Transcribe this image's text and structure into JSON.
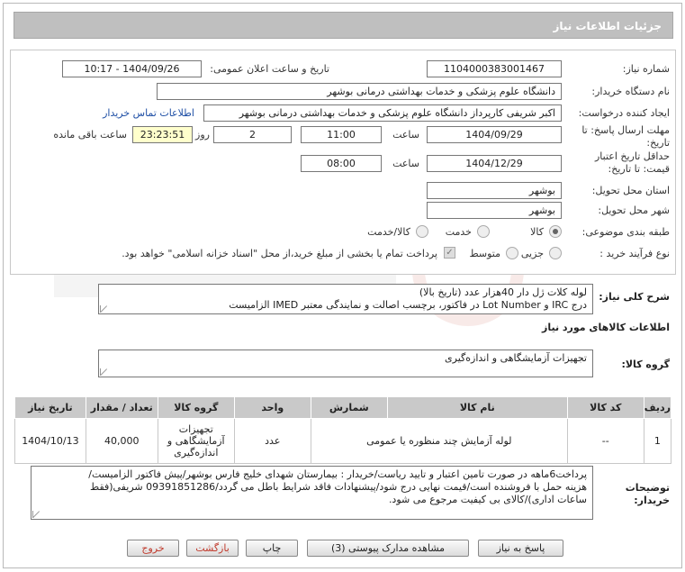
{
  "header": {
    "title": "جزئیات اطلاعات نیاز"
  },
  "fields": {
    "need_number_label": "شماره نیاز:",
    "need_number": "1104000383001467",
    "announce_label": "تاریخ و ساعت اعلان عمومی:",
    "announce_value": "1404/09/26 - 10:17",
    "buyer_org_label": "نام دستگاه خریدار:",
    "buyer_org": "دانشگاه علوم پزشکی و خدمات بهداشتی درمانی بوشهر",
    "creator_label": "ایجاد کننده درخواست:",
    "creator": "اکبر شریفی کارپرداز دانشگاه علوم پزشکی و خدمات بهداشتی درمانی بوشهر",
    "contact_link": "اطلاعات تماس خریدار",
    "deadline_label": "مهلت ارسال پاسخ: تا تاریخ:",
    "deadline_date": "1404/09/29",
    "time_label": "ساعت",
    "deadline_time": "11:00",
    "days_value": "2",
    "days_label": "روز و",
    "remaining_time": "23:23:51",
    "remaining_label": "ساعت باقی مانده",
    "validity_label": "حداقل تاریخ اعتبار قیمت: تا تاریخ:",
    "validity_date": "1404/12/29",
    "validity_time": "08:00",
    "province_label": "استان محل تحویل:",
    "province": "بوشهر",
    "city_label": "شهر محل تحویل:",
    "city": "بوشهر",
    "category_label": "طبقه بندی موضوعی:",
    "category_options": [
      "کالا",
      "خدمت",
      "کالا/خدمت"
    ],
    "process_label": "نوع فرآیند خرید :",
    "process_options": [
      "جزیی",
      "متوسط"
    ],
    "payment_note": "پرداخت تمام یا بخشی از مبلغ خرید،از محل \"اسناد خزانه اسلامی\" خواهد بود."
  },
  "description": {
    "label": "شرح کلی نیاز:",
    "line1": "لوله کلات ژل دار 40هزار عدد (تاریخ بالا)",
    "line2": "درج IRC و Lot Number در فاکتور، برچسب اصالت و نمایندگی معتبر IMED الزامیست"
  },
  "goods_info": {
    "title": "اطلاعات کالاهای مورد نیاز"
  },
  "goods_group": {
    "label": "گروه کالا:",
    "value": "تجهیزات آزمایشگاهی و اندازه‌گیری"
  },
  "table": {
    "headers": [
      "ردیف",
      "کد کالا",
      "نام کالا",
      "شمارش",
      "واحد",
      "گروه کالا",
      "تعداد / مقدار",
      "تاریخ نیاز"
    ],
    "rows": [
      {
        "row": "1",
        "code": "--",
        "name": "لوله آزمایش چند منظوره یا عمومی",
        "unit": "عدد",
        "group": "تجهیزات آزمایشگاهی و اندازه‌گیری",
        "qty": "40,000",
        "date": "1404/10/13"
      }
    ]
  },
  "buyer_notes": {
    "label": "توضیحات خریدار:",
    "line1": "پرداخت6ماهه در صورت تامین اعتبار و تایید ریاست/خریدار : بیمارستان شهدای خلیج فارس بوشهر/پیش فاکتور الزامیست/",
    "line2": "هزینه حمل با فروشنده است/قیمت نهایی درج شود/پیشنهادات فاقد شرایط باطل می گردد/09391851286 شریفی(فقط",
    "line3": "ساعات اداری)/کالای بی کیفیت مرجوع می شود."
  },
  "buttons": {
    "reply": "پاسخ به نیاز",
    "docs": "مشاهده مدارک پیوستی (3)",
    "print": "چاپ",
    "back": "بازگشت",
    "exit": "خروج"
  },
  "colors": {
    "header_bg": "#bfbfbf",
    "link": "#1f4fa5",
    "yellow": "#ffffcc"
  }
}
